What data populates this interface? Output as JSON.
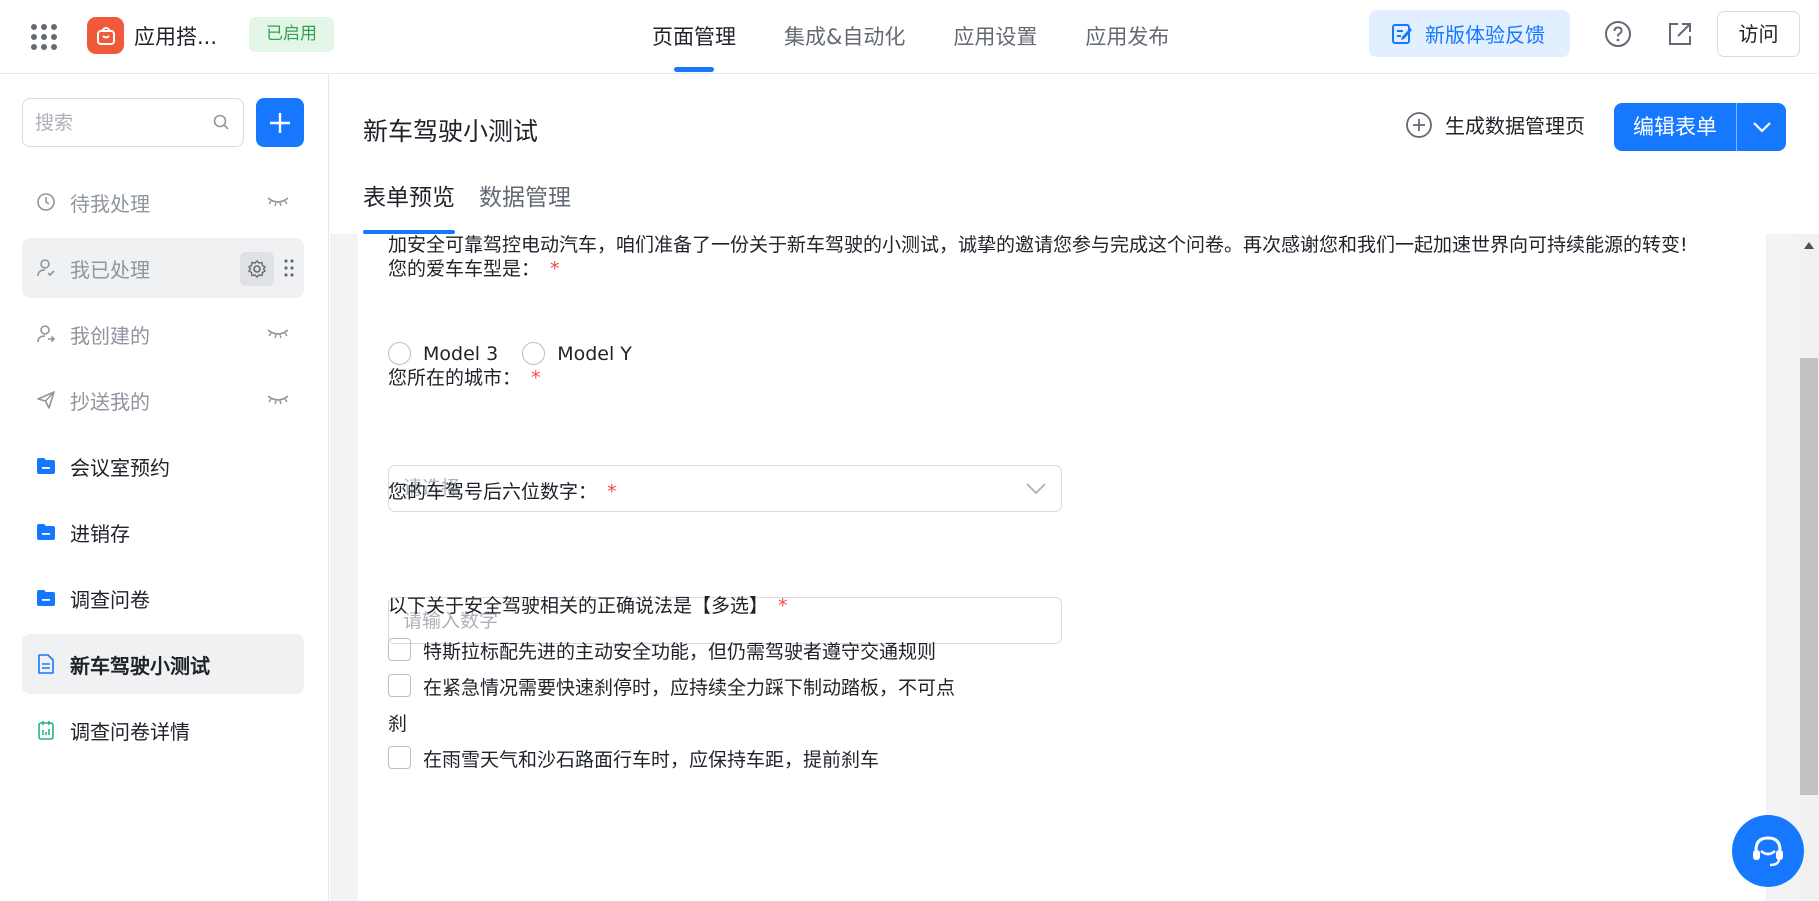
{
  "header": {
    "app_name": "应用搭...",
    "status_badge": "已启用",
    "nav_tabs": [
      {
        "label": "页面管理",
        "active": true
      },
      {
        "label": "集成&自动化"
      },
      {
        "label": "应用设置"
      },
      {
        "label": "应用发布"
      }
    ],
    "feedback_label": "新版体验反馈",
    "visit_label": "访问"
  },
  "sidebar": {
    "search_placeholder": "搜索",
    "items": [
      {
        "label": "待我处理",
        "icon": "clock-icon"
      },
      {
        "label": "我已处理",
        "icon": "user-check-icon"
      },
      {
        "label": "我创建的",
        "icon": "user-share-icon"
      },
      {
        "label": "抄送我的",
        "icon": "send-icon"
      },
      {
        "label": "会议室预约",
        "icon": "folder-icon"
      },
      {
        "label": "进销存",
        "icon": "folder-icon"
      },
      {
        "label": "调查问卷",
        "icon": "folder-icon"
      },
      {
        "label": "新车驾驶小测试",
        "icon": "form-icon"
      },
      {
        "label": "调查问卷详情",
        "icon": "dashboard-icon"
      }
    ]
  },
  "page": {
    "title": "新车驾驶小测试",
    "generate_label": "生成数据管理页",
    "edit_label": "编辑表单",
    "tabs": [
      {
        "label": "表单预览",
        "active": true
      },
      {
        "label": "数据管理"
      }
    ]
  },
  "form": {
    "intro": "加安全可靠驾控电动汽车，咱们准备了一份关于新车驾驶的小测试，诚挚的邀请您参与完成这个问卷。再次感谢您和我们一起加速世界向可持续能源的转变!",
    "q1": {
      "label": "您的爱车车型是：",
      "options": [
        "Model 3",
        "Model Y"
      ]
    },
    "q2": {
      "label": "您所在的城市：",
      "placeholder": "请选择"
    },
    "q3": {
      "label": "您的车驾号后六位数字：",
      "placeholder": "请输入数字"
    },
    "q4": {
      "label": "以下关于安全驾驶相关的正确说法是【多选】",
      "options": [
        "特斯拉标配先进的主动安全功能，但仍需驾驶者遵守交通规则",
        "在紧急情况需要快速刹停时，应持续全力踩下制动踏板，不可点",
        "在雨雪天气和沙石路面行车时，应保持车距，提前刹车"
      ],
      "option2_wrap": "刹"
    },
    "required_mark": "*"
  },
  "colors": {
    "accent": "#1677ff",
    "required": "#f54a45",
    "badge_bg": "#e3f6e8",
    "badge_text": "#2ea44f"
  }
}
